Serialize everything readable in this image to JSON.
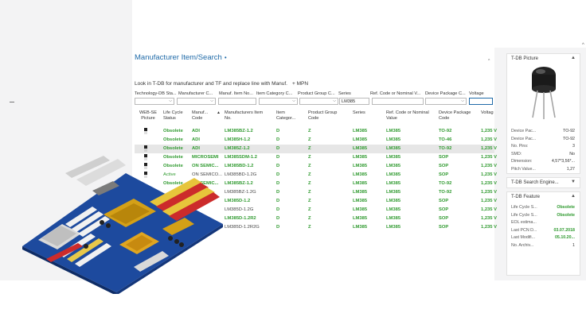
{
  "page": {
    "title": "Manufacturer Item/Search",
    "title_caret": "•"
  },
  "hint": {
    "text": "Look in T-DB for manufacturer and TF and replace line with Manuf.",
    "mpn": "+ MPN"
  },
  "filters": {
    "labels": [
      "Technology-DB Sta...",
      "Manufacturer C...",
      "Manuf. Item No...",
      "Item Category C...",
      "Product Group C...",
      "Series",
      "Ref. Code or Nominal V...",
      "Device Package C...",
      "Voltage"
    ],
    "series_value": "LM385",
    "dropdown_icon": "chevron-down-icon"
  },
  "grid": {
    "headers": [
      "WEB-SE Picture",
      "Life Cycle Status",
      "Manuf... Code",
      "Manufacturers Item No.",
      "Item Categor...",
      "Product Group Code",
      "Series",
      "Ref. Code or Nominal Value",
      "Device Package Code",
      "Voltag"
    ],
    "sort_icon": "▲",
    "rows": [
      {
        "status": "Obsolete",
        "manuf": "ADI",
        "item": "LM385BZ-1.2",
        "cat": "D",
        "pg": "Z",
        "series": "LM385",
        "ref": "LM385",
        "pkg": "TO-92",
        "volt": "1,235 V",
        "pic": true,
        "dark": false
      },
      {
        "status": "Obsolete",
        "manuf": "ADI",
        "item": "LM385H-1.2",
        "cat": "D",
        "pg": "Z",
        "series": "LM385",
        "ref": "LM385",
        "pkg": "TO-46",
        "volt": "1,235 V",
        "pic": false,
        "dark": false
      },
      {
        "status": "Obsolete",
        "manuf": "ADI",
        "item": "LM385Z-1.2",
        "cat": "D",
        "pg": "Z",
        "series": "LM385",
        "ref": "LM385",
        "pkg": "TO-92",
        "volt": "1,235 V",
        "pic": true,
        "dark": false,
        "selected": true
      },
      {
        "status": "Obsolete",
        "manuf": "MICROSEMI",
        "item": "LM385SDM-1.2",
        "cat": "D",
        "pg": "Z",
        "series": "LM385",
        "ref": "LM385",
        "pkg": "SOP",
        "volt": "1,235 V",
        "pic": true,
        "dark": false
      },
      {
        "status": "Obsolete",
        "manuf": "ON SEMIC...",
        "item": "LM385BD-1.2",
        "cat": "D",
        "pg": "Z",
        "series": "LM385",
        "ref": "LM385",
        "pkg": "SOP",
        "volt": "1,235 V",
        "pic": true,
        "dark": false
      },
      {
        "status": "Active",
        "manuf": "ON SEMICO...",
        "item": "LM385BD-1.2G",
        "cat": "D",
        "pg": "Z",
        "series": "LM385",
        "ref": "LM385",
        "pkg": "SOP",
        "volt": "1,235 V",
        "pic": true,
        "dark": true
      },
      {
        "status": "Obsolete",
        "manuf": "ON SEMIC...",
        "item": "LM385BZ-1.2",
        "cat": "D",
        "pg": "Z",
        "series": "LM385",
        "ref": "LM385",
        "pkg": "TO-92",
        "volt": "1,235 V",
        "pic": false,
        "dark": false
      },
      {
        "status": "",
        "manuf": "",
        "item": "LM385BZ-1.2G",
        "cat": "D",
        "pg": "Z",
        "series": "LM385",
        "ref": "LM385",
        "pkg": "TO-92",
        "volt": "1,235 V",
        "pic": false,
        "dark": true
      },
      {
        "status": "",
        "manuf": "",
        "item": "LM385D-1.2",
        "cat": "D",
        "pg": "Z",
        "series": "LM385",
        "ref": "LM385",
        "pkg": "SOP",
        "volt": "1,235 V",
        "pic": false,
        "dark": false
      },
      {
        "status": "",
        "manuf": "",
        "item": "LM385D-1.2G",
        "cat": "D",
        "pg": "Z",
        "series": "LM385",
        "ref": "LM385",
        "pkg": "SOP",
        "volt": "1,235 V",
        "pic": false,
        "dark": true
      },
      {
        "status": "",
        "manuf": "",
        "item": "LM385D-1.2R2",
        "cat": "D",
        "pg": "Z",
        "series": "LM385",
        "ref": "LM385",
        "pkg": "SOP",
        "volt": "1,235 V",
        "pic": false,
        "dark": false
      },
      {
        "status": "",
        "manuf": "",
        "item": "LM385D-1.2R2G",
        "cat": "D",
        "pg": "Z",
        "series": "LM385",
        "ref": "LM385",
        "pkg": "SOP",
        "volt": "1,235 V",
        "pic": false,
        "dark": true
      }
    ]
  },
  "right": {
    "picture": {
      "title": "T-DB Picture",
      "caret": "▲",
      "specs": [
        {
          "k": "Device Pac...",
          "v": "TO-92"
        },
        {
          "k": "Device Pac...",
          "v": "TO-92"
        },
        {
          "k": "No. Pins:",
          "v": "3"
        },
        {
          "k": "SMD:",
          "v": "No"
        },
        {
          "k": "Dimension:",
          "v": "4,57*3,56*..."
        },
        {
          "k": "Pitch Value...",
          "v": "1,27"
        }
      ]
    },
    "search_engine": {
      "title": "T-DB Search Engine...",
      "caret": "▼"
    },
    "feature": {
      "title": "T-DB Feature",
      "caret": "▲",
      "specs": [
        {
          "k": "Life Cycle S...",
          "v": "Obsolete",
          "green": true
        },
        {
          "k": "Life Cycle S...",
          "v": "Obsolete",
          "green": true
        },
        {
          "k": "EOL estima...",
          "v": ""
        },
        {
          "k": "Last PCN D...",
          "v": "03.07.2018",
          "green": true
        },
        {
          "k": "Last Modifi...",
          "v": "05.10.20...",
          "green": true
        },
        {
          "k": "No. Archiv...",
          "v": "1"
        }
      ]
    }
  }
}
